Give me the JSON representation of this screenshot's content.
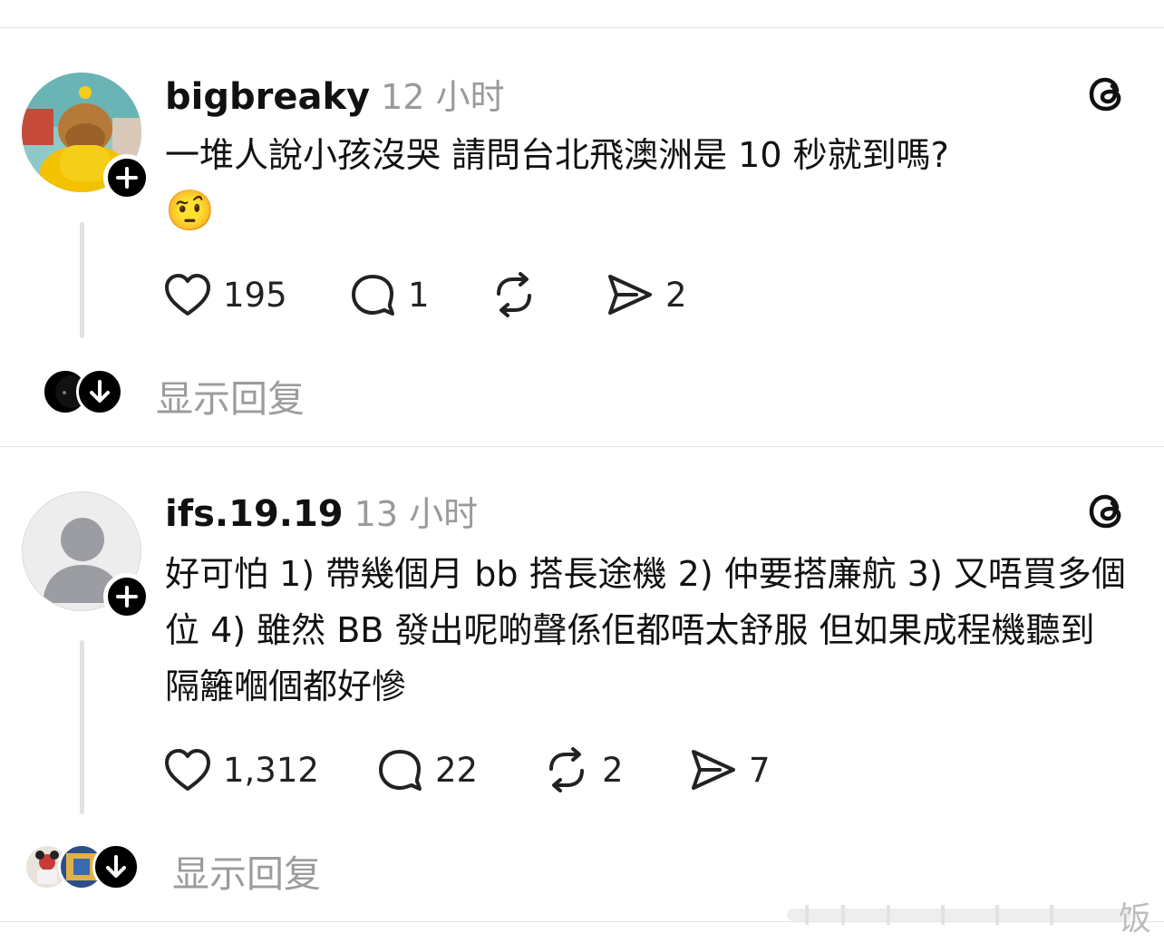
{
  "posts": [
    {
      "username": "bigbreaky",
      "time": "12 小时",
      "text": "一堆人說小孩沒哭 請問台北飛澳洲是 10 秒就到嗎?",
      "emoji": "🤨",
      "likes": "195",
      "comments": "1",
      "reposts": "",
      "shares": "2",
      "show_replies": "显示回复"
    },
    {
      "username": "ifs.19.19",
      "time": "13 小时",
      "text": "好可怕  1) 帶幾個月 bb 搭長途機 2) 仲要搭廉航 3) 又唔買多個位 4) 雖然 BB 發出呢啲聲係佢都唔太舒服 但如果成程機聽到 隔籬嗰個都好慘",
      "likes": "1,312",
      "comments": "22",
      "reposts": "2",
      "shares": "7",
      "show_replies": "显示回复"
    }
  ],
  "watermark": "饭",
  "icons": {
    "follow": "plus-icon",
    "threads": "threads-logo-icon",
    "like": "heart-icon",
    "comment": "comment-bubble-icon",
    "repost": "repost-icon",
    "share": "send-icon",
    "expand": "arrow-down-icon"
  }
}
